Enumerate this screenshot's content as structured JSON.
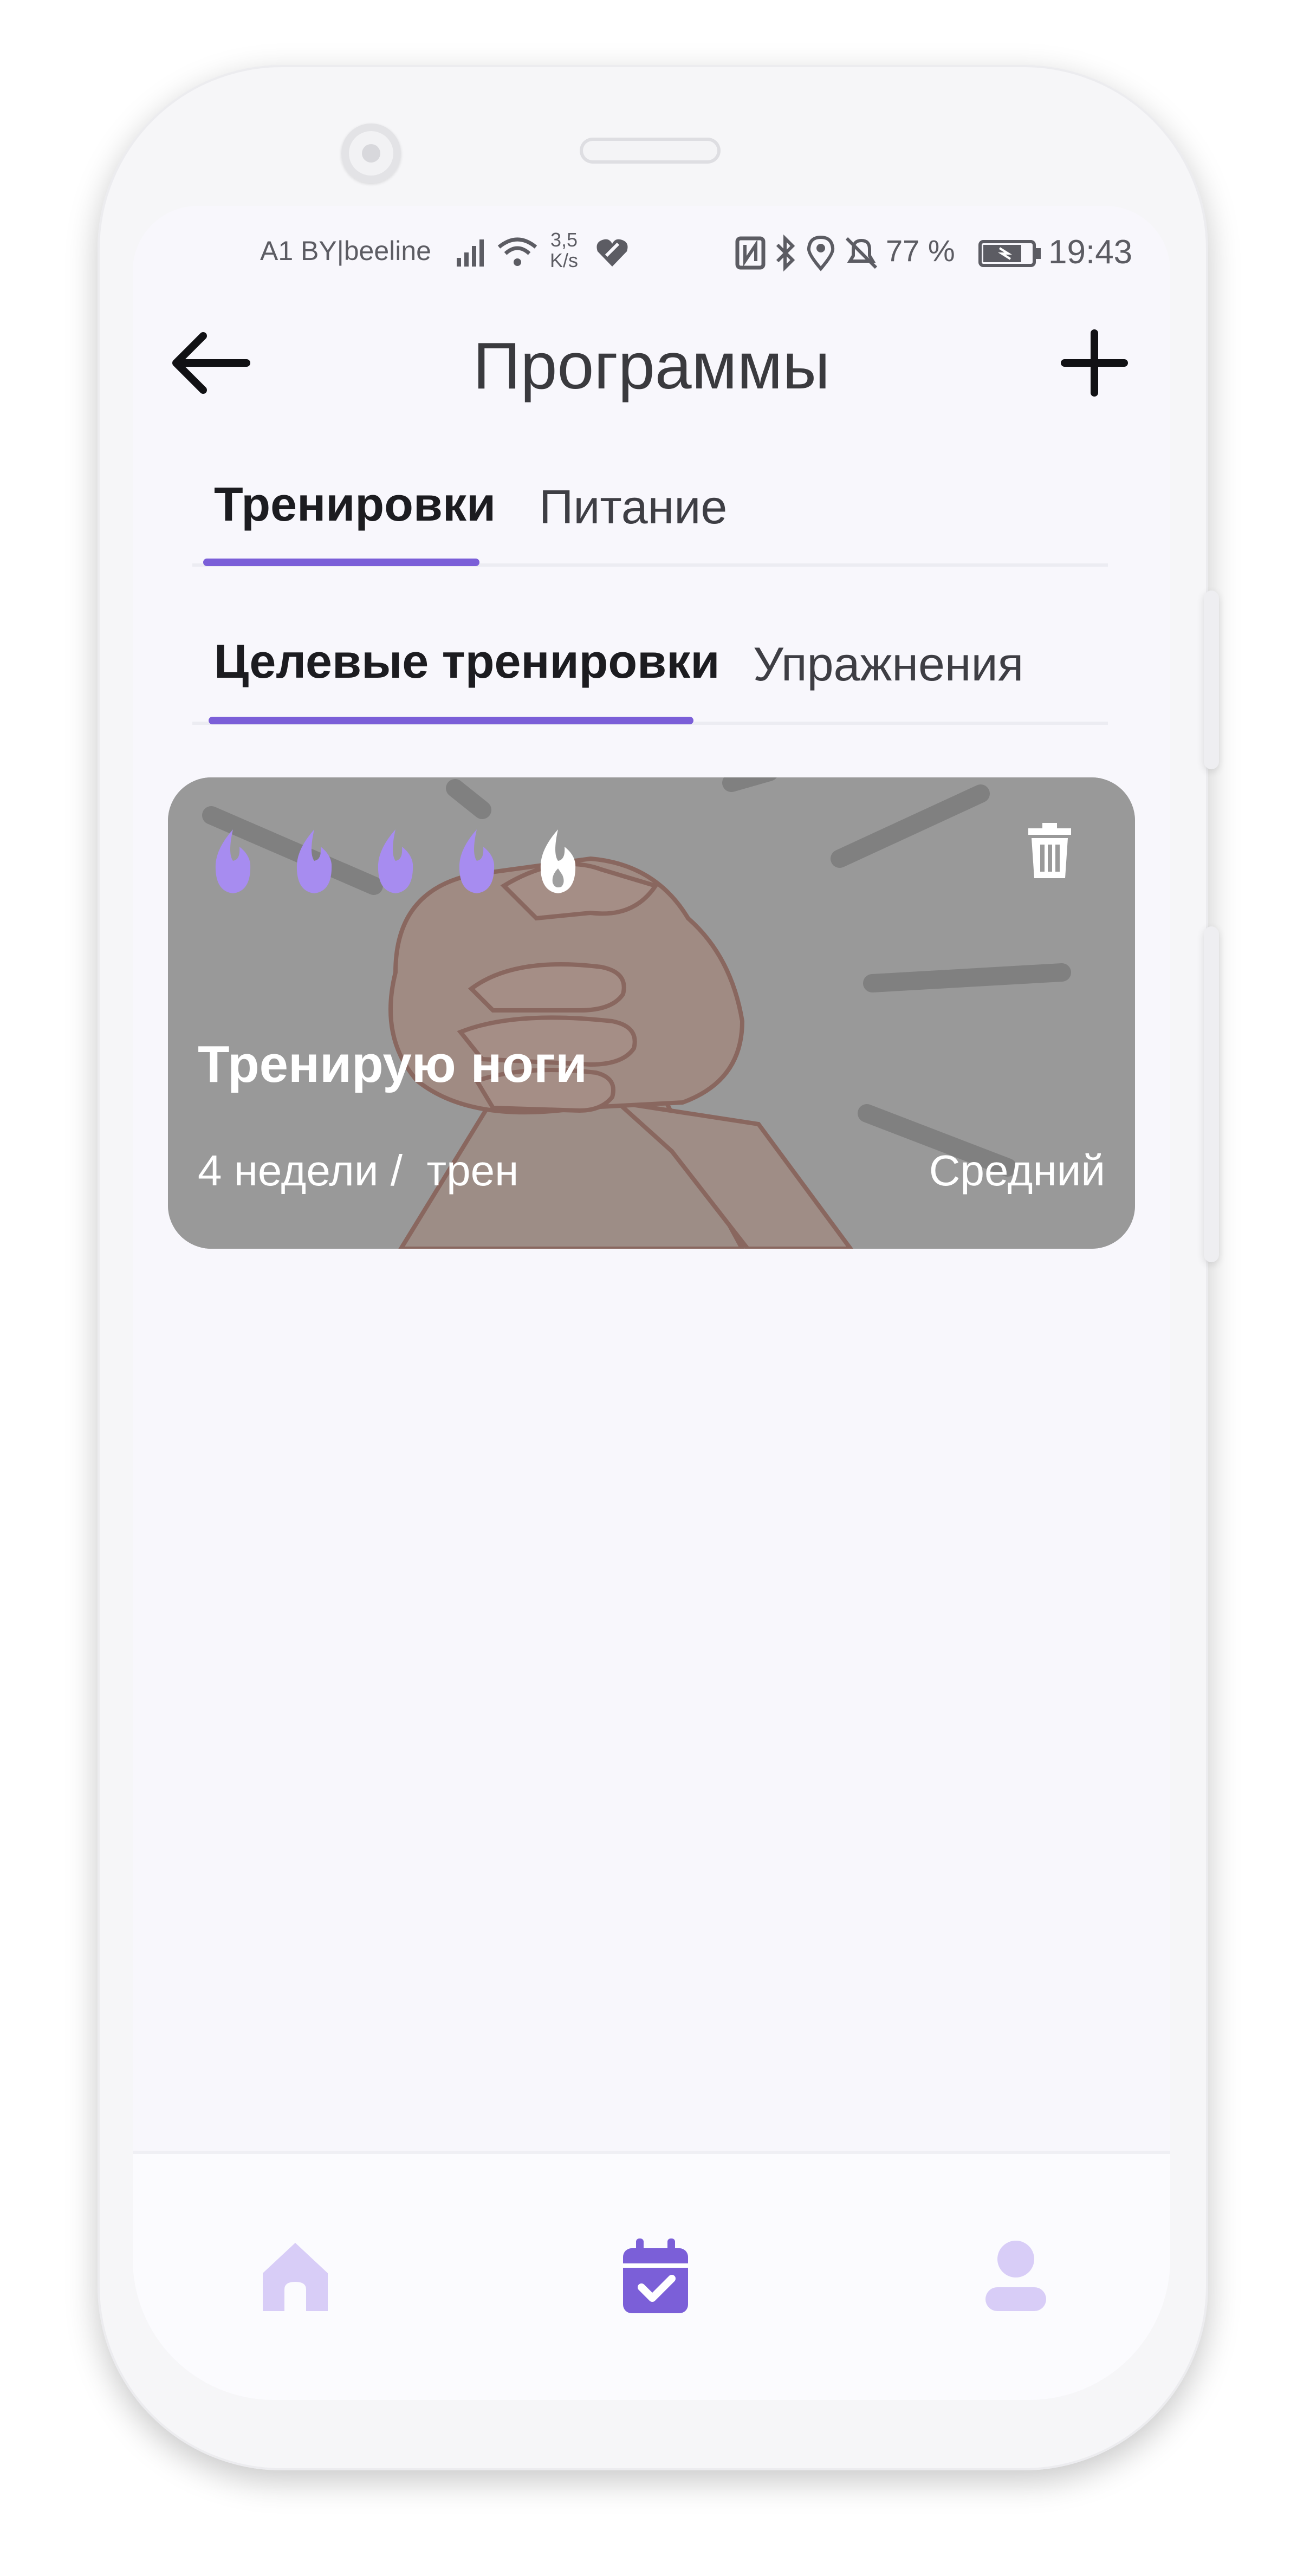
{
  "status_bar": {
    "carrier": "A1 BY|beeline",
    "net_speed_value": "3,5",
    "net_speed_unit": "K/s",
    "battery": "77 %",
    "time": "19:43"
  },
  "header": {
    "title": "Программы",
    "back_icon": "arrow-left-icon",
    "add_icon": "plus-icon"
  },
  "tabs_primary": [
    {
      "label": "Тренировки",
      "active": true
    },
    {
      "label": "Питание",
      "active": false
    }
  ],
  "tabs_secondary": [
    {
      "label": "Целевые тренировки",
      "active": true
    },
    {
      "label": "Упражнения",
      "active": false
    }
  ],
  "program_card": {
    "title": "Тренирую ноги",
    "duration": "4 недели",
    "separator": "/",
    "unit": "трен",
    "level": "Средний",
    "intensity_flames_total": 5,
    "intensity_flames_filled": 4,
    "colors": {
      "flame_filled": "#a78cf0",
      "flame_empty": "#ffffff"
    }
  },
  "bottom_nav": [
    {
      "icon": "home-icon",
      "active": false
    },
    {
      "icon": "calendar-check-icon",
      "active": true
    },
    {
      "icon": "profile-icon",
      "active": false
    }
  ],
  "colors": {
    "accent": "#7b5fd8",
    "accent_light": "#d8cdf7"
  }
}
